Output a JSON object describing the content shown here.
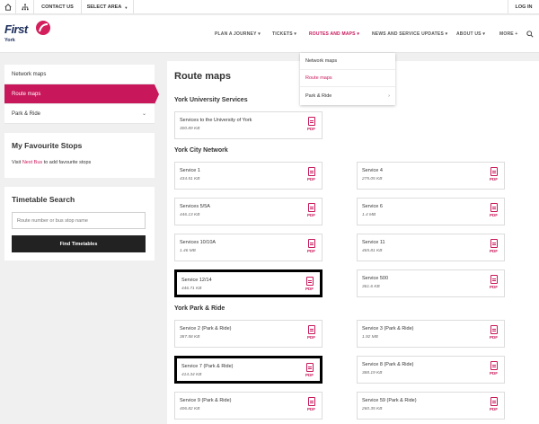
{
  "utility": {
    "contact": "CONTACT US",
    "area": "SELECT AREA",
    "login": "LOG IN"
  },
  "logo": {
    "name": "First",
    "sub": "York"
  },
  "nav": [
    {
      "label": "PLAN A JOURNEY",
      "active": false
    },
    {
      "label": "TICKETS",
      "active": false
    },
    {
      "label": "ROUTES AND MAPS",
      "active": true
    },
    {
      "label": "NEWS AND SERVICE UPDATES",
      "active": false
    },
    {
      "label": "ABOUT US",
      "active": false
    },
    {
      "label": "MORE",
      "active": false
    }
  ],
  "dropdown": [
    "Network maps",
    "Route maps",
    "Park & Ride"
  ],
  "sidebar": {
    "items": [
      "Network maps",
      "Route maps",
      "Park & Ride"
    ]
  },
  "favourites": {
    "title": "My Favourite Stops",
    "prefix": "Visit",
    "link": "Next Bus",
    "suffix": "to add favourite stops"
  },
  "timetable": {
    "title": "Timetable Search",
    "placeholder": "Route number or bus stop name",
    "button": "Find Timetables"
  },
  "main": {
    "title": "Route maps",
    "pdf_label": "PDF",
    "sections": [
      {
        "title": "York University Services",
        "cards": [
          {
            "name": "Services to the University of York",
            "size": "300.89 KB",
            "highlight": false
          }
        ]
      },
      {
        "title": "York City Network",
        "cards": [
          {
            "name": "Service 1",
            "size": "434.51 KB",
            "highlight": false
          },
          {
            "name": "Service 4",
            "size": "275.05 KB",
            "highlight": false
          },
          {
            "name": "Services 5/5A",
            "size": "446.13 KB",
            "highlight": false
          },
          {
            "name": "Service 6",
            "size": "1.4 MB",
            "highlight": false
          },
          {
            "name": "Services 10/10A",
            "size": "1.46 MB",
            "highlight": false
          },
          {
            "name": "Service 11",
            "size": "465.81 KB",
            "highlight": false
          },
          {
            "name": "Service 12/14",
            "size": "446.71 KB",
            "highlight": true
          },
          {
            "name": "Service 500",
            "size": "361.6 KB",
            "highlight": false
          }
        ]
      },
      {
        "title": "York Park & Ride",
        "cards": [
          {
            "name": "Service 2 (Park & Ride)",
            "size": "387.58 KB",
            "highlight": false
          },
          {
            "name": "Service 3 (Park & Ride)",
            "size": "1.92 MB",
            "highlight": false
          },
          {
            "name": "Service 7 (Park & Ride)",
            "size": "414.34 KB",
            "highlight": true
          },
          {
            "name": "Service 8 (Park & Ride)",
            "size": "388.19 KB",
            "highlight": false
          },
          {
            "name": "Service 9 (Park & Ride)",
            "size": "406.82 KB",
            "highlight": false
          },
          {
            "name": "Service 59 (Park & Ride)",
            "size": "260.35 KB",
            "highlight": false
          }
        ]
      }
    ]
  },
  "colors": {
    "brand": "#c8175a",
    "navy": "#1b2d5b",
    "highlight": "#000000"
  }
}
